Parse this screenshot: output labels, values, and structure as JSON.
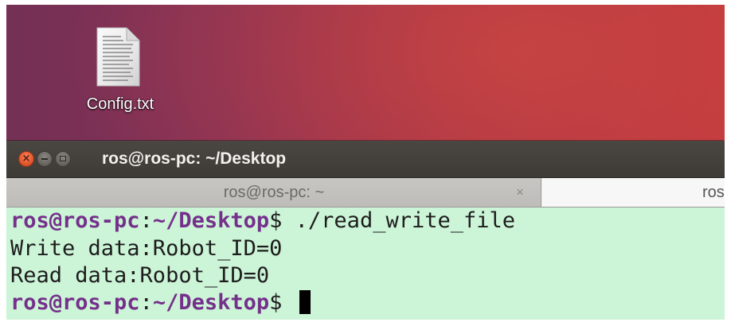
{
  "desktop": {
    "icons": [
      {
        "label": "Config.txt",
        "icon": "text-file-icon"
      }
    ]
  },
  "terminal": {
    "title": "ros@ros-pc: ~/Desktop",
    "window_controls": [
      {
        "name": "close",
        "icon": "close-icon",
        "glyph": "×"
      },
      {
        "name": "minimize",
        "icon": "minimize-icon"
      },
      {
        "name": "maximize",
        "icon": "maximize-icon"
      }
    ],
    "tabs": [
      {
        "label": "ros@ros-pc: ~",
        "close_label": "×",
        "active": false
      },
      {
        "label": "ros",
        "active": true
      }
    ],
    "lines": [
      {
        "user": "ros@ros-pc",
        "sep": ":",
        "path": "~/Desktop",
        "prompt": "$",
        "command": " ./read_write_file"
      },
      {
        "text": "Write data:Robot_ID=0"
      },
      {
        "text": "Read data:Robot_ID=0"
      },
      {
        "user": "ros@ros-pc",
        "sep": ":",
        "path": "~/Desktop",
        "prompt": "$",
        "command": " "
      }
    ]
  },
  "colors": {
    "wallpaper_left": "#743055",
    "wallpaper_right": "#c0383f",
    "terminal_background": "#ccf4d7",
    "prompt_color": "#74308a",
    "titlebar": "#3e3b37"
  }
}
